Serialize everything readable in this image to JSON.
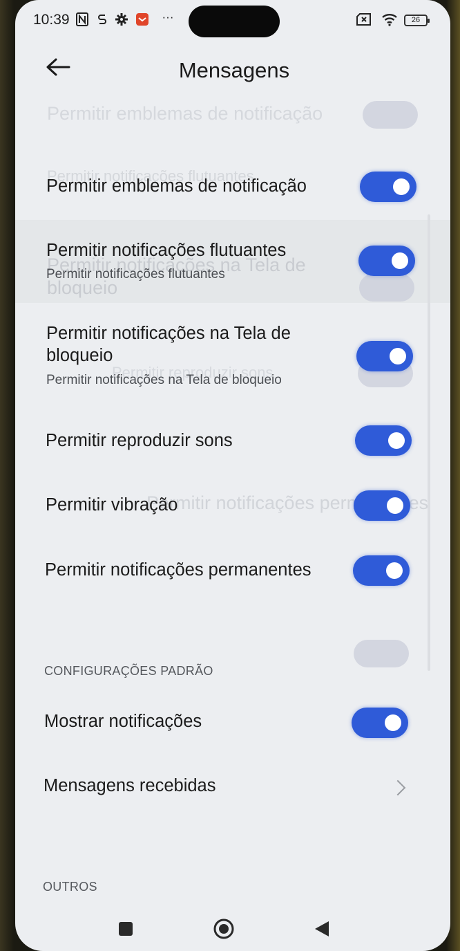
{
  "status_bar": {
    "time": "10:39",
    "battery": "26",
    "more": "···",
    "icons": [
      "nfc-icon",
      "data-saver-icon",
      "gear-icon",
      "app-notification-icon",
      "more-icon",
      "sim-x-icon",
      "wifi-icon",
      "battery-icon"
    ]
  },
  "header": {
    "title": "Mensagens",
    "back_icon": "arrow-left-icon"
  },
  "settings": [
    {
      "title": "Permitir emblemas de notificação",
      "subtitle": "",
      "enabled": true
    },
    {
      "title": "Permitir notificações flutuantes",
      "subtitle": "Permitir notificações flutuantes",
      "enabled": true
    },
    {
      "title_line1": "Permitir notificações na Tela de",
      "title_line2": "bloqueio",
      "subtitle": "Permitir notificações na Tela de bloqueio",
      "enabled": true
    },
    {
      "title": "Permitir reproduzir sons",
      "subtitle": "",
      "enabled": true
    },
    {
      "title": "Permitir vibração",
      "subtitle": "",
      "enabled": true
    },
    {
      "title": "Permitir notificações permanentes",
      "subtitle": "",
      "enabled": true
    }
  ],
  "defaults_section": {
    "header": "CONFIGURAÇÕES PADRÃO",
    "show_notifications": {
      "title": "Mostrar notificações",
      "enabled": true
    },
    "received_messages": {
      "title": "Mensagens recebidas",
      "chevron_icon": "chevron-right-icon"
    }
  },
  "others_section": {
    "header": "OUTROS"
  },
  "ghost_text": {
    "top": "Permitir emblemas de notificação",
    "floating": "Permitir notificações flutuantes",
    "lockscreen_line1": "Permitir notificações na Tela de",
    "lockscreen_line2": "bloqueio",
    "sounds": "Permitir reproduzir sons",
    "permanent": "Permitir notificações permanentes"
  },
  "nav_bar": {
    "icons": [
      "square-recents-icon",
      "circle-home-icon",
      "triangle-back-icon"
    ]
  },
  "colors": {
    "accent": "#2f5bd8",
    "background": "#eceef1",
    "text": "#1b1b1b"
  }
}
